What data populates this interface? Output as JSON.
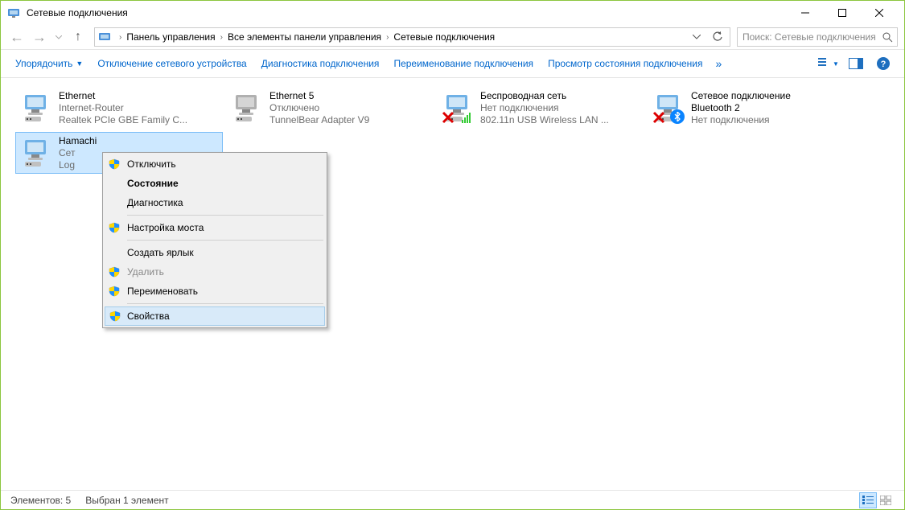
{
  "window": {
    "title": "Сетевые подключения"
  },
  "breadcrumb": {
    "items": [
      "Панель управления",
      "Все элементы панели управления",
      "Сетевые подключения"
    ]
  },
  "search": {
    "placeholder": "Поиск: Сетевые подключения"
  },
  "toolbar": {
    "organize": "Упорядочить",
    "disable": "Отключение сетевого устройства",
    "diagnose": "Диагностика подключения",
    "rename": "Переименование подключения",
    "status": "Просмотр состояния подключения"
  },
  "connections": [
    {
      "name": "Ethernet",
      "status": "Internet-Router",
      "device": "Realtek PCIe GBE Family C...",
      "icon": "net",
      "overlay_x": false,
      "overlay_signal": false,
      "overlay_bt": false
    },
    {
      "name": "Ethernet 5",
      "status": "Отключено",
      "device": "TunnelBear Adapter V9",
      "icon": "net",
      "overlay_x": false,
      "overlay_signal": false,
      "overlay_bt": false,
      "gray": true
    },
    {
      "name": "Беспроводная сеть",
      "status": "Нет подключения",
      "device": "802.11n USB Wireless LAN ...",
      "icon": "net",
      "overlay_x": true,
      "overlay_signal": true,
      "overlay_bt": false
    },
    {
      "name": "Сетевое подключение Bluetooth 2",
      "status": "Нет подключения",
      "device": "",
      "icon": "net",
      "overlay_x": true,
      "overlay_signal": false,
      "overlay_bt": true
    },
    {
      "name": "Hamachi",
      "status": "Сет",
      "device": "Log",
      "icon": "net",
      "overlay_x": false,
      "overlay_signal": false,
      "overlay_bt": false,
      "selected": true
    }
  ],
  "context_menu": {
    "items": [
      {
        "label": "Отключить",
        "shield": true
      },
      {
        "label": "Состояние",
        "bold": true
      },
      {
        "label": "Диагностика"
      },
      {
        "separator": true
      },
      {
        "label": "Настройка моста",
        "shield": true
      },
      {
        "separator": true
      },
      {
        "label": "Создать ярлык"
      },
      {
        "label": "Удалить",
        "shield": true,
        "disabled": true
      },
      {
        "label": "Переименовать",
        "shield": true
      },
      {
        "separator": true
      },
      {
        "label": "Свойства",
        "shield": true,
        "hover": true
      }
    ]
  },
  "statusbar": {
    "count": "Элементов: 5",
    "selected": "Выбран 1 элемент"
  }
}
